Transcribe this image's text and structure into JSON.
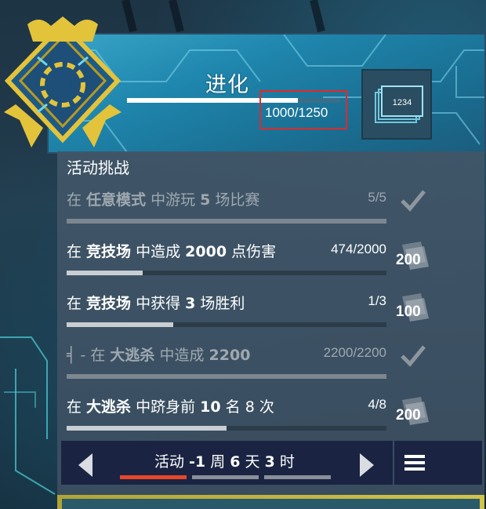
{
  "header": {
    "title": "进化",
    "progress_text": "1000/1250",
    "progress_fraction": 0.8,
    "reward_card_label": "1234"
  },
  "challenges": {
    "heading": "活动挑战",
    "items": [
      {
        "prefix": "在 ",
        "mode": "任意模式",
        "middle": " 中游玩 ",
        "amount": "5",
        "suffix": " 场比赛",
        "count": "5/5",
        "reward": "",
        "status": "complete",
        "fraction": 1.0
      },
      {
        "prefix": "在 ",
        "mode": "竞技场",
        "middle": " 中造成 ",
        "amount": "2000",
        "suffix": " 点伤害",
        "count": "474/2000",
        "reward": "200",
        "status": "active",
        "fraction": 0.237
      },
      {
        "prefix": "在 ",
        "mode": "竞技场",
        "middle": " 中获得 ",
        "amount": "3",
        "suffix": " 场胜利",
        "count": "1/3",
        "reward": "100",
        "status": "active",
        "fraction": 0.333
      },
      {
        "prefix": "╡  -   在 ",
        "mode": "大逃杀",
        "middle": " 中造成 ",
        "amount": "2200",
        "suffix": "",
        "count": "2200/2200",
        "reward": "",
        "status": "complete",
        "fraction": 1.0
      },
      {
        "prefix": "在 ",
        "mode": "大逃杀",
        "middle": " 中跻身前 ",
        "amount": "10",
        "suffix": " 名 8 次",
        "count": "4/8",
        "reward": "200",
        "status": "active",
        "fraction": 0.5
      }
    ]
  },
  "footer": {
    "timer_prefix": "活动 ",
    "timer_weeks": "-1",
    "timer_week_unit": " 周 ",
    "timer_days": "6",
    "timer_day_unit": " 天 ",
    "timer_hours": "3",
    "timer_hour_unit": " 时",
    "active_page": 0,
    "page_count": 3
  },
  "colors": {
    "accent_red": "#e8472a",
    "highlight_red": "#e02a2a",
    "emblem_gold": "#e3c33a",
    "header_cyan": "#2a95bd"
  },
  "icons": [
    "emblem-icon",
    "reward-card-icon",
    "check-icon",
    "reward-badge-icon",
    "chevron-left-icon",
    "chevron-right-icon",
    "menu-icon"
  ]
}
